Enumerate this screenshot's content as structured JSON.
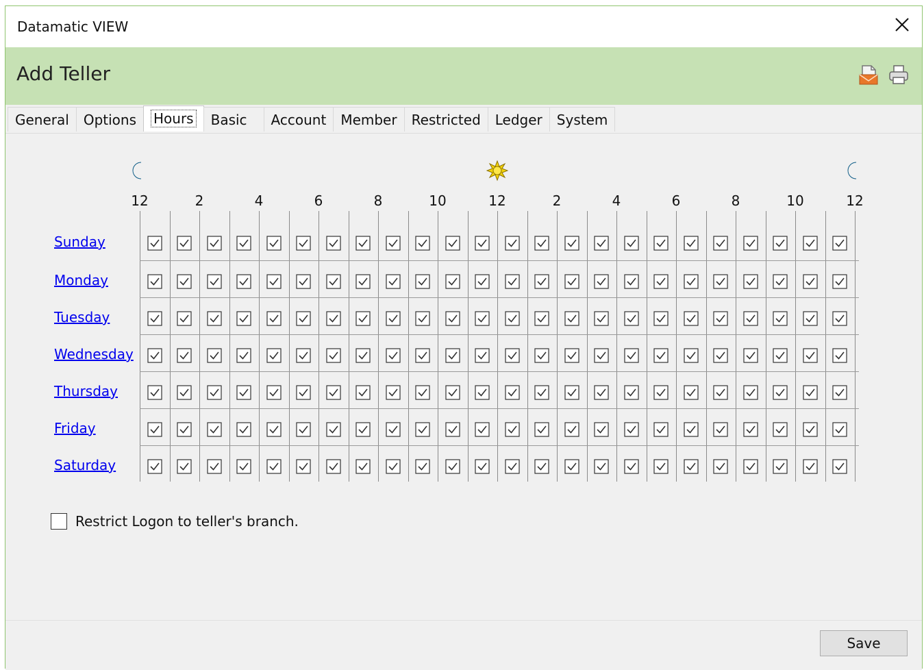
{
  "window": {
    "title": "Datamatic VIEW"
  },
  "header": {
    "title": "Add Teller",
    "icons": [
      "mail-icon",
      "print-icon"
    ]
  },
  "tabs": [
    {
      "label": "General",
      "active": false
    },
    {
      "label": "Options",
      "active": false
    },
    {
      "label": "Hours",
      "active": true
    },
    {
      "label": "Basic",
      "active": false
    },
    {
      "label": "Account",
      "active": false
    },
    {
      "label": "Member",
      "active": false
    },
    {
      "label": "Restricted",
      "active": false
    },
    {
      "label": "Ledger",
      "active": false
    },
    {
      "label": "System",
      "active": false
    }
  ],
  "hours": {
    "period_icons": [
      "moon-icon",
      "sun-icon",
      "moon-icon"
    ],
    "hour_labels": [
      "12",
      "2",
      "4",
      "6",
      "8",
      "10",
      "12",
      "2",
      "4",
      "6",
      "8",
      "10",
      "12"
    ],
    "days": [
      "Sunday",
      "Monday",
      "Tuesday",
      "Wednesday",
      "Thursday",
      "Friday",
      "Saturday"
    ],
    "slots_per_day": 24,
    "all_checked": true
  },
  "restrict": {
    "label": "Restrict Logon to teller's branch.",
    "checked": false
  },
  "footer": {
    "save_label": "Save"
  },
  "colors": {
    "header_bg": "#c6e1b4",
    "window_border": "#8fc46e",
    "link": "#0000ee",
    "panel_bg": "#f0f0f0"
  }
}
